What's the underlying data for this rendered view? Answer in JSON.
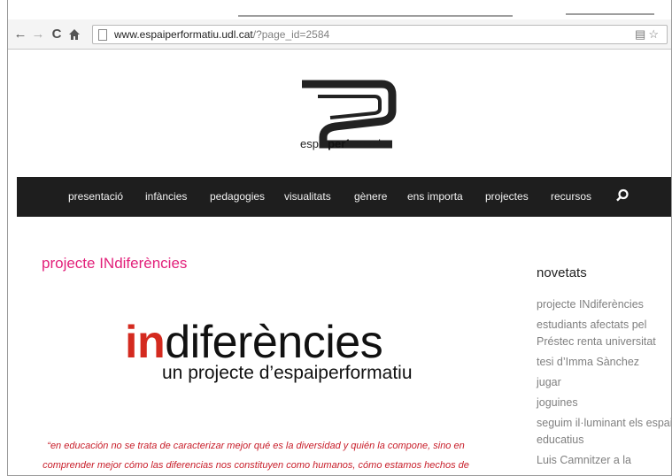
{
  "browser": {
    "url_host": "www.espaiperformatiu.udl.cat",
    "url_path": "/?page_id=2584",
    "icons": [
      "back-arrow-icon",
      "forward-arrow-icon",
      "reload-icon",
      "home-icon",
      "page-icon",
      "translate-icon",
      "star-icon"
    ]
  },
  "site": {
    "logo_text_pre": "espai",
    "logo_text_bold": "per",
    "logo_text_post": "formatiu",
    "nav": [
      "presentació",
      "infàncies",
      "pedagogies",
      "visualitats",
      "gènere",
      "ens importa",
      "projectes",
      "recursos"
    ]
  },
  "post": {
    "title": "projecte INdiferències",
    "banner_highlight": "in",
    "banner_rest": "diferències",
    "banner_subtitle": "un projecte d’espaiperformatiu",
    "quote_line1": "“en educación no se trata de caracterizar mejor qué es la diversidad y quién la compone, sino en",
    "quote_line2": "comprender mejor cómo las diferencias nos constituyen como humanos, cómo estamos hechos de"
  },
  "sidebar": {
    "title": "novetats",
    "items": [
      "projecte INdiferències",
      "estudiants afectats pel Préstec renta universitat",
      "tesi d’Imma Sànchez",
      "jugar",
      "joguines",
      "seguim il·luminant els espais educatius",
      "Luis Camnitzer a la"
    ]
  },
  "colors": {
    "accent_pink": "#e2207a",
    "banner_red": "#d42a1f",
    "quote_red": "#c81e2a",
    "nav_bg": "#1e1e1e"
  }
}
